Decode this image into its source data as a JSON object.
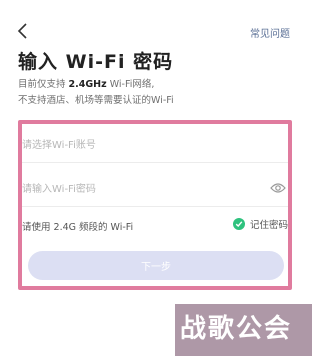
{
  "header": {
    "back_icon": "chevron-left-icon",
    "faq_label": "常见问题"
  },
  "title": "输入 Wi-Fi 密码",
  "description": {
    "prefix": "目前仅支持",
    "bold": "2.4GHz",
    "suffix": "Wi-Fi网络,",
    "line2": "不支持酒店、机场等需要认证的Wi-Fi"
  },
  "form": {
    "ssid_placeholder": "请选择Wi-Fi账号",
    "ssid_value": "",
    "password_placeholder": "请输入Wi-Fi密码",
    "password_value": "",
    "eye_icon": "eye-icon",
    "hint": "请使用 2.4G 频段的 Wi-Fi",
    "remember_label": "记住密码",
    "remember_checked": true,
    "next_label": "下一步"
  },
  "watermark": "战歌公会",
  "colors": {
    "highlight_border": "#e07b9e",
    "check_green": "#2ec27e",
    "button_disabled": "#dcdff3",
    "faq_link": "#5a6f95"
  }
}
